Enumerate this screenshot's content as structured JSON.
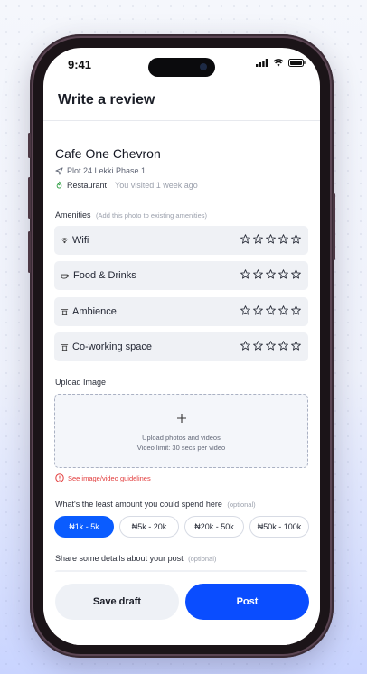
{
  "status_bar": {
    "time": "9:41"
  },
  "header": {
    "title": "Write a review"
  },
  "place": {
    "name": "Cafe One Chevron",
    "address": "Plot 24 Lekki Phase 1",
    "category": "Restaurant",
    "visited": "You visited 1 week ago"
  },
  "amenities": {
    "label": "Amenities",
    "hint": "(Add this photo to existing amenities)",
    "items": [
      {
        "label": "Wifi",
        "icon": "wifi-icon",
        "rating": 0
      },
      {
        "label": "Food & Drinks",
        "icon": "food-drinks-icon",
        "rating": 0
      },
      {
        "label": "Ambience",
        "icon": "ambience-icon",
        "rating": 0
      },
      {
        "label": "Co-working space",
        "icon": "coworking-icon",
        "rating": 0
      }
    ]
  },
  "upload": {
    "label": "Upload Image",
    "line1": "Upload photos and videos",
    "line2": "Video limit: 30 secs per video",
    "guidelines": "See image/video guidelines"
  },
  "spend": {
    "question": "What's the least amount you could spend here",
    "hint": "(optional)",
    "options": [
      "₦1k - 5k",
      "₦5k - 20k",
      "₦20k - 50k",
      "₦50k - 100k"
    ],
    "selected": "₦1k - 5k"
  },
  "details": {
    "label": "Share some details about your post",
    "hint": "(optional)"
  },
  "actions": {
    "save_draft": "Save draft",
    "post": "Post"
  },
  "colors": {
    "accent": "#0a4dff",
    "error": "#e23b3b",
    "surface": "#eff1f5"
  }
}
